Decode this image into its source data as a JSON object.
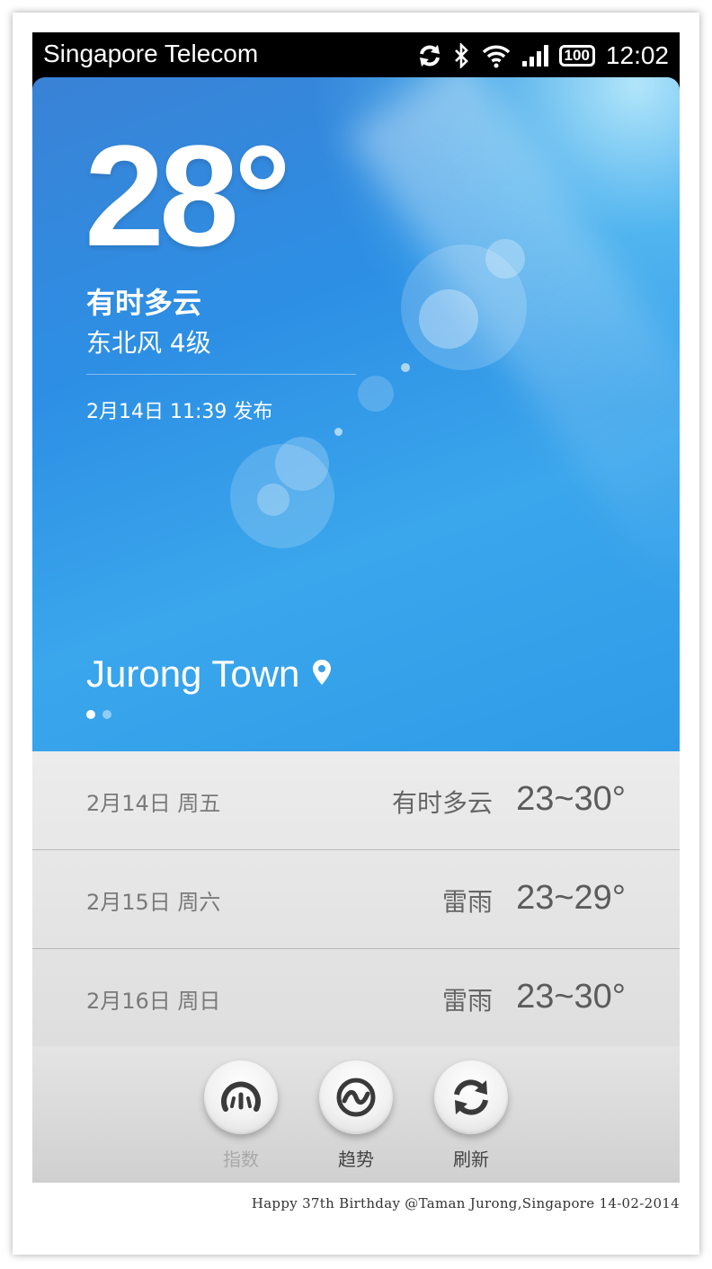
{
  "status_bar": {
    "carrier": "Singapore Telecom",
    "battery": "100",
    "time": "12:02",
    "icons": [
      "sync-icon",
      "bluetooth-icon",
      "wifi-icon",
      "signal-icon",
      "battery-icon"
    ]
  },
  "current": {
    "temperature": "28°",
    "condition": "有时多云",
    "wind": "东北风 4级",
    "published": "2月14日 11:39 发布",
    "city": "Jurong Town",
    "city_icon": "location-pin-icon",
    "page_count": 2,
    "active_page": 1
  },
  "forecast": [
    {
      "date": "2月14日 周五",
      "condition": "有时多云",
      "range": "23~30°"
    },
    {
      "date": "2月15日 周六",
      "condition": "雷雨",
      "range": "23~29°"
    },
    {
      "date": "2月16日 周日",
      "condition": "雷雨",
      "range": "23~30°"
    }
  ],
  "toolbar": {
    "index_label": "指数",
    "trend_label": "趋势",
    "refresh_label": "刷新"
  },
  "caption": "Happy 37th Birthday @Taman Jurong,Singapore 14-02-2014",
  "colors": {
    "hero_blue": "#2f8fe3",
    "list_bg": "#e6e6e6",
    "icon_dark": "#3a3a3a"
  }
}
